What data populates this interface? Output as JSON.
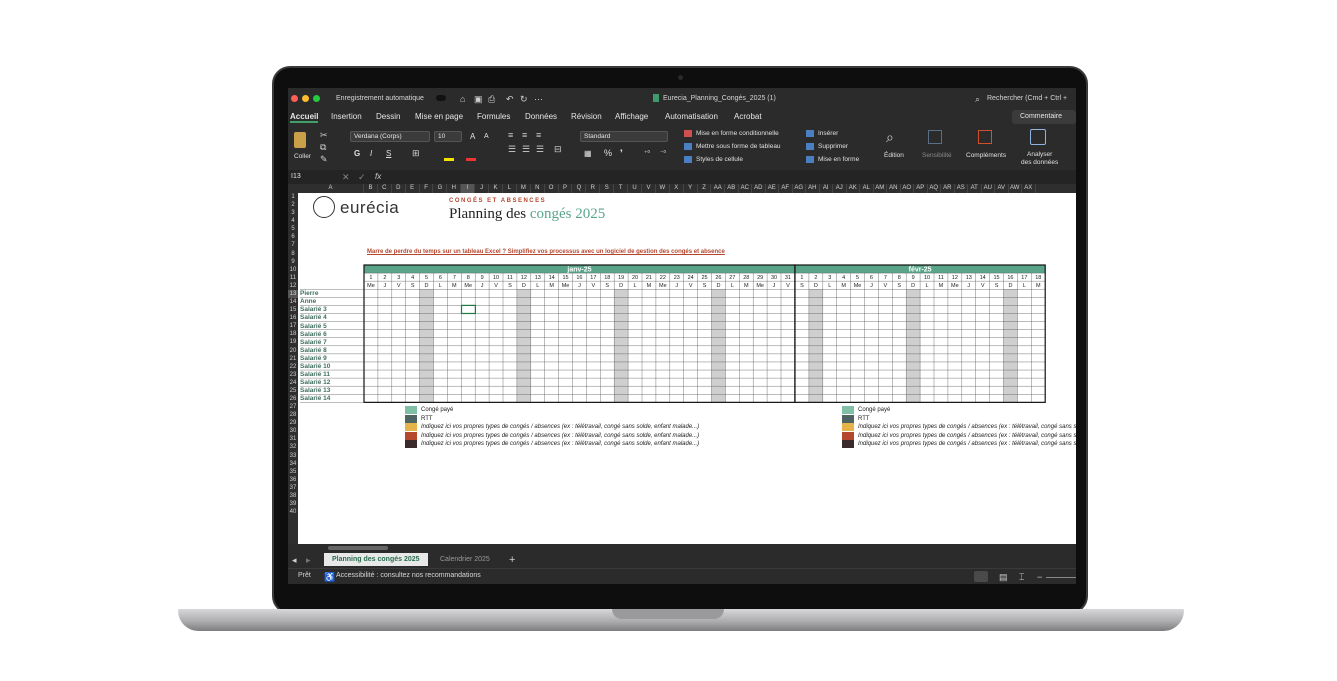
{
  "titlebar": {
    "autosave_label": "Enregistrement automatique",
    "filename": "Eurecia_Planning_Congés_2025 (1)",
    "search_placeholder": "Rechercher (Cmd + Ctrl +"
  },
  "ribbon_tabs": [
    "Accueil",
    "Insertion",
    "Dessin",
    "Mise en page",
    "Formules",
    "Données",
    "Révision",
    "Affichage",
    "Automatisation",
    "Acrobat"
  ],
  "comments_button": "Commentaire",
  "ribbon": {
    "paste_label": "Coller",
    "font_name": "Verdana (Corps)",
    "font_size": "10",
    "bold": "G",
    "italic": "I",
    "underline": "S",
    "number_format": "Standard",
    "conditional_format": "Mise en forme conditionnelle",
    "format_table": "Mettre sous forme de tableau",
    "cell_styles": "Styles de cellule",
    "insert": "Insérer",
    "delete": "Supprimer",
    "format": "Mise en forme",
    "editing": "Édition",
    "sensitivity": "Sensibilité",
    "addins": "Compléments",
    "analyze_1": "Analyser",
    "analyze_2": "des données"
  },
  "formula_bar": {
    "cell_ref": "I13",
    "fx": "fx"
  },
  "columns": [
    "A",
    "B",
    "C",
    "D",
    "E",
    "F",
    "G",
    "H",
    "I",
    "J",
    "K",
    "L",
    "M",
    "N",
    "O",
    "P",
    "Q",
    "R",
    "S",
    "T",
    "U",
    "V",
    "W",
    "X",
    "Y",
    "Z",
    "AA",
    "AB",
    "AC",
    "AD",
    "AE",
    "AF",
    "AG",
    "AH",
    "AI",
    "AJ",
    "AK",
    "AL",
    "AM",
    "AN",
    "AO",
    "AP",
    "AQ",
    "AR",
    "AS",
    "AT",
    "AU",
    "AV",
    "AW",
    "AX"
  ],
  "rows": [
    "1",
    "2",
    "3",
    "4",
    "5",
    "6",
    "7",
    "8",
    "9",
    "10",
    "11",
    "12",
    "13",
    "14",
    "15",
    "16",
    "17",
    "18",
    "19",
    "20",
    "21",
    "22",
    "23",
    "24",
    "25",
    "26",
    "27",
    "28",
    "29",
    "30",
    "31",
    "32",
    "33",
    "34",
    "35",
    "36",
    "37",
    "38",
    "39",
    "40"
  ],
  "header": {
    "brand": "eurécia",
    "kicker": "CONGÉS ET ABSENCES",
    "title_main": "Planning des ",
    "title_accent": "congés 2025",
    "promo": "Marre de perdre du temps sur un tableau Excel ? Simplifiez vos processus avec un logiciel de gestion des congés et absence"
  },
  "months": [
    {
      "label": "janv-25",
      "days": 31,
      "weekdays": [
        "Me",
        "J",
        "V",
        "S",
        "D",
        "L",
        "M",
        "Me",
        "J",
        "V",
        "S",
        "D",
        "L",
        "M",
        "Me",
        "J",
        "V",
        "S",
        "D",
        "L",
        "M",
        "Me",
        "J",
        "V",
        "S",
        "D",
        "L",
        "M",
        "Me",
        "J",
        "V"
      ]
    },
    {
      "label": "févr-25",
      "days": 18,
      "weekdays": [
        "S",
        "D",
        "L",
        "M",
        "Me",
        "J",
        "V",
        "S",
        "D",
        "L",
        "M",
        "Me",
        "J",
        "V",
        "S",
        "D",
        "L",
        "M"
      ]
    }
  ],
  "employees": [
    "Pierre",
    "Anne",
    "Salarié 3",
    "Salarié 4",
    "Salarié 5",
    "Salarié 6",
    "Salarié 7",
    "Salarié 8",
    "Salarié 9",
    "Salarié 10",
    "Salarié 11",
    "Salarié 12",
    "Salarié 13",
    "Salarié 14"
  ],
  "legend": [
    {
      "label": "Congé payé",
      "color": "#7fbfa6"
    },
    {
      "label": "RTT",
      "color": "#4e6462"
    },
    {
      "label": "Indiquez ici vos propres types de congés / absences (ex : télétravail, congé sans solde, enfant malade...)",
      "color": "#e6b34a"
    },
    {
      "label": "Indiquez ici vos propres types de congés / absences (ex : télétravail, congé sans solde, enfant malade...)",
      "color": "#b5472f"
    },
    {
      "label": "Indiquez ici vos propres types de congés / absences (ex : télétravail, congé sans solde, enfant malade...)",
      "color": "#3a2a2a"
    }
  ],
  "sheet_tabs": [
    "Planning des congés 2025",
    "Calendrier 2025"
  ],
  "status": {
    "ready": "Prêt",
    "accessibility": "Accessibilité : consultez nos recommandations"
  }
}
